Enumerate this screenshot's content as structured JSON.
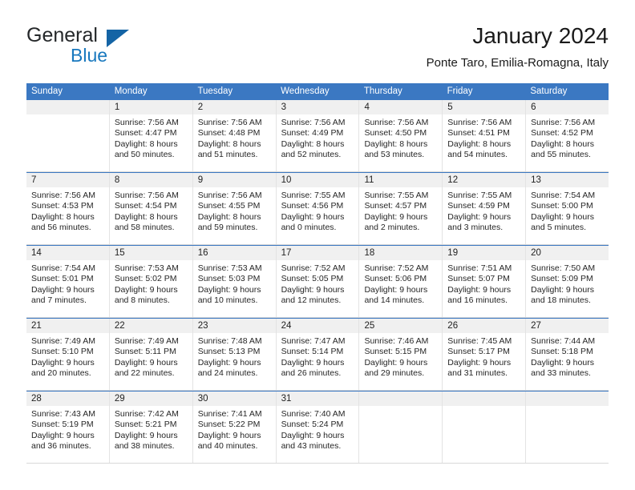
{
  "brand": {
    "name_part1": "General",
    "name_part2": "Blue",
    "triangle_icon": "triangle-icon",
    "colors": {
      "blue": "#1878BE",
      "dark": "#25282A",
      "triangle": "#1464A5"
    }
  },
  "header": {
    "title": "January 2024",
    "subtitle": "Ponte Taro, Emilia-Romagna, Italy"
  },
  "calendar": {
    "header_bg": "#3B78C2",
    "daynum_bg": "#F0F0F0",
    "weekdays": [
      "Sunday",
      "Monday",
      "Tuesday",
      "Wednesday",
      "Thursday",
      "Friday",
      "Saturday"
    ],
    "weeks": [
      [
        {
          "day": "",
          "lines": []
        },
        {
          "day": "1",
          "lines": [
            "Sunrise: 7:56 AM",
            "Sunset: 4:47 PM",
            "Daylight: 8 hours",
            "and 50 minutes."
          ]
        },
        {
          "day": "2",
          "lines": [
            "Sunrise: 7:56 AM",
            "Sunset: 4:48 PM",
            "Daylight: 8 hours",
            "and 51 minutes."
          ]
        },
        {
          "day": "3",
          "lines": [
            "Sunrise: 7:56 AM",
            "Sunset: 4:49 PM",
            "Daylight: 8 hours",
            "and 52 minutes."
          ]
        },
        {
          "day": "4",
          "lines": [
            "Sunrise: 7:56 AM",
            "Sunset: 4:50 PM",
            "Daylight: 8 hours",
            "and 53 minutes."
          ]
        },
        {
          "day": "5",
          "lines": [
            "Sunrise: 7:56 AM",
            "Sunset: 4:51 PM",
            "Daylight: 8 hours",
            "and 54 minutes."
          ]
        },
        {
          "day": "6",
          "lines": [
            "Sunrise: 7:56 AM",
            "Sunset: 4:52 PM",
            "Daylight: 8 hours",
            "and 55 minutes."
          ]
        }
      ],
      [
        {
          "day": "7",
          "lines": [
            "Sunrise: 7:56 AM",
            "Sunset: 4:53 PM",
            "Daylight: 8 hours",
            "and 56 minutes."
          ]
        },
        {
          "day": "8",
          "lines": [
            "Sunrise: 7:56 AM",
            "Sunset: 4:54 PM",
            "Daylight: 8 hours",
            "and 58 minutes."
          ]
        },
        {
          "day": "9",
          "lines": [
            "Sunrise: 7:56 AM",
            "Sunset: 4:55 PM",
            "Daylight: 8 hours",
            "and 59 minutes."
          ]
        },
        {
          "day": "10",
          "lines": [
            "Sunrise: 7:55 AM",
            "Sunset: 4:56 PM",
            "Daylight: 9 hours",
            "and 0 minutes."
          ]
        },
        {
          "day": "11",
          "lines": [
            "Sunrise: 7:55 AM",
            "Sunset: 4:57 PM",
            "Daylight: 9 hours",
            "and 2 minutes."
          ]
        },
        {
          "day": "12",
          "lines": [
            "Sunrise: 7:55 AM",
            "Sunset: 4:59 PM",
            "Daylight: 9 hours",
            "and 3 minutes."
          ]
        },
        {
          "day": "13",
          "lines": [
            "Sunrise: 7:54 AM",
            "Sunset: 5:00 PM",
            "Daylight: 9 hours",
            "and 5 minutes."
          ]
        }
      ],
      [
        {
          "day": "14",
          "lines": [
            "Sunrise: 7:54 AM",
            "Sunset: 5:01 PM",
            "Daylight: 9 hours",
            "and 7 minutes."
          ]
        },
        {
          "day": "15",
          "lines": [
            "Sunrise: 7:53 AM",
            "Sunset: 5:02 PM",
            "Daylight: 9 hours",
            "and 8 minutes."
          ]
        },
        {
          "day": "16",
          "lines": [
            "Sunrise: 7:53 AM",
            "Sunset: 5:03 PM",
            "Daylight: 9 hours",
            "and 10 minutes."
          ]
        },
        {
          "day": "17",
          "lines": [
            "Sunrise: 7:52 AM",
            "Sunset: 5:05 PM",
            "Daylight: 9 hours",
            "and 12 minutes."
          ]
        },
        {
          "day": "18",
          "lines": [
            "Sunrise: 7:52 AM",
            "Sunset: 5:06 PM",
            "Daylight: 9 hours",
            "and 14 minutes."
          ]
        },
        {
          "day": "19",
          "lines": [
            "Sunrise: 7:51 AM",
            "Sunset: 5:07 PM",
            "Daylight: 9 hours",
            "and 16 minutes."
          ]
        },
        {
          "day": "20",
          "lines": [
            "Sunrise: 7:50 AM",
            "Sunset: 5:09 PM",
            "Daylight: 9 hours",
            "and 18 minutes."
          ]
        }
      ],
      [
        {
          "day": "21",
          "lines": [
            "Sunrise: 7:49 AM",
            "Sunset: 5:10 PM",
            "Daylight: 9 hours",
            "and 20 minutes."
          ]
        },
        {
          "day": "22",
          "lines": [
            "Sunrise: 7:49 AM",
            "Sunset: 5:11 PM",
            "Daylight: 9 hours",
            "and 22 minutes."
          ]
        },
        {
          "day": "23",
          "lines": [
            "Sunrise: 7:48 AM",
            "Sunset: 5:13 PM",
            "Daylight: 9 hours",
            "and 24 minutes."
          ]
        },
        {
          "day": "24",
          "lines": [
            "Sunrise: 7:47 AM",
            "Sunset: 5:14 PM",
            "Daylight: 9 hours",
            "and 26 minutes."
          ]
        },
        {
          "day": "25",
          "lines": [
            "Sunrise: 7:46 AM",
            "Sunset: 5:15 PM",
            "Daylight: 9 hours",
            "and 29 minutes."
          ]
        },
        {
          "day": "26",
          "lines": [
            "Sunrise: 7:45 AM",
            "Sunset: 5:17 PM",
            "Daylight: 9 hours",
            "and 31 minutes."
          ]
        },
        {
          "day": "27",
          "lines": [
            "Sunrise: 7:44 AM",
            "Sunset: 5:18 PM",
            "Daylight: 9 hours",
            "and 33 minutes."
          ]
        }
      ],
      [
        {
          "day": "28",
          "lines": [
            "Sunrise: 7:43 AM",
            "Sunset: 5:19 PM",
            "Daylight: 9 hours",
            "and 36 minutes."
          ]
        },
        {
          "day": "29",
          "lines": [
            "Sunrise: 7:42 AM",
            "Sunset: 5:21 PM",
            "Daylight: 9 hours",
            "and 38 minutes."
          ]
        },
        {
          "day": "30",
          "lines": [
            "Sunrise: 7:41 AM",
            "Sunset: 5:22 PM",
            "Daylight: 9 hours",
            "and 40 minutes."
          ]
        },
        {
          "day": "31",
          "lines": [
            "Sunrise: 7:40 AM",
            "Sunset: 5:24 PM",
            "Daylight: 9 hours",
            "and 43 minutes."
          ]
        },
        {
          "day": "",
          "lines": []
        },
        {
          "day": "",
          "lines": []
        },
        {
          "day": "",
          "lines": []
        }
      ]
    ]
  }
}
